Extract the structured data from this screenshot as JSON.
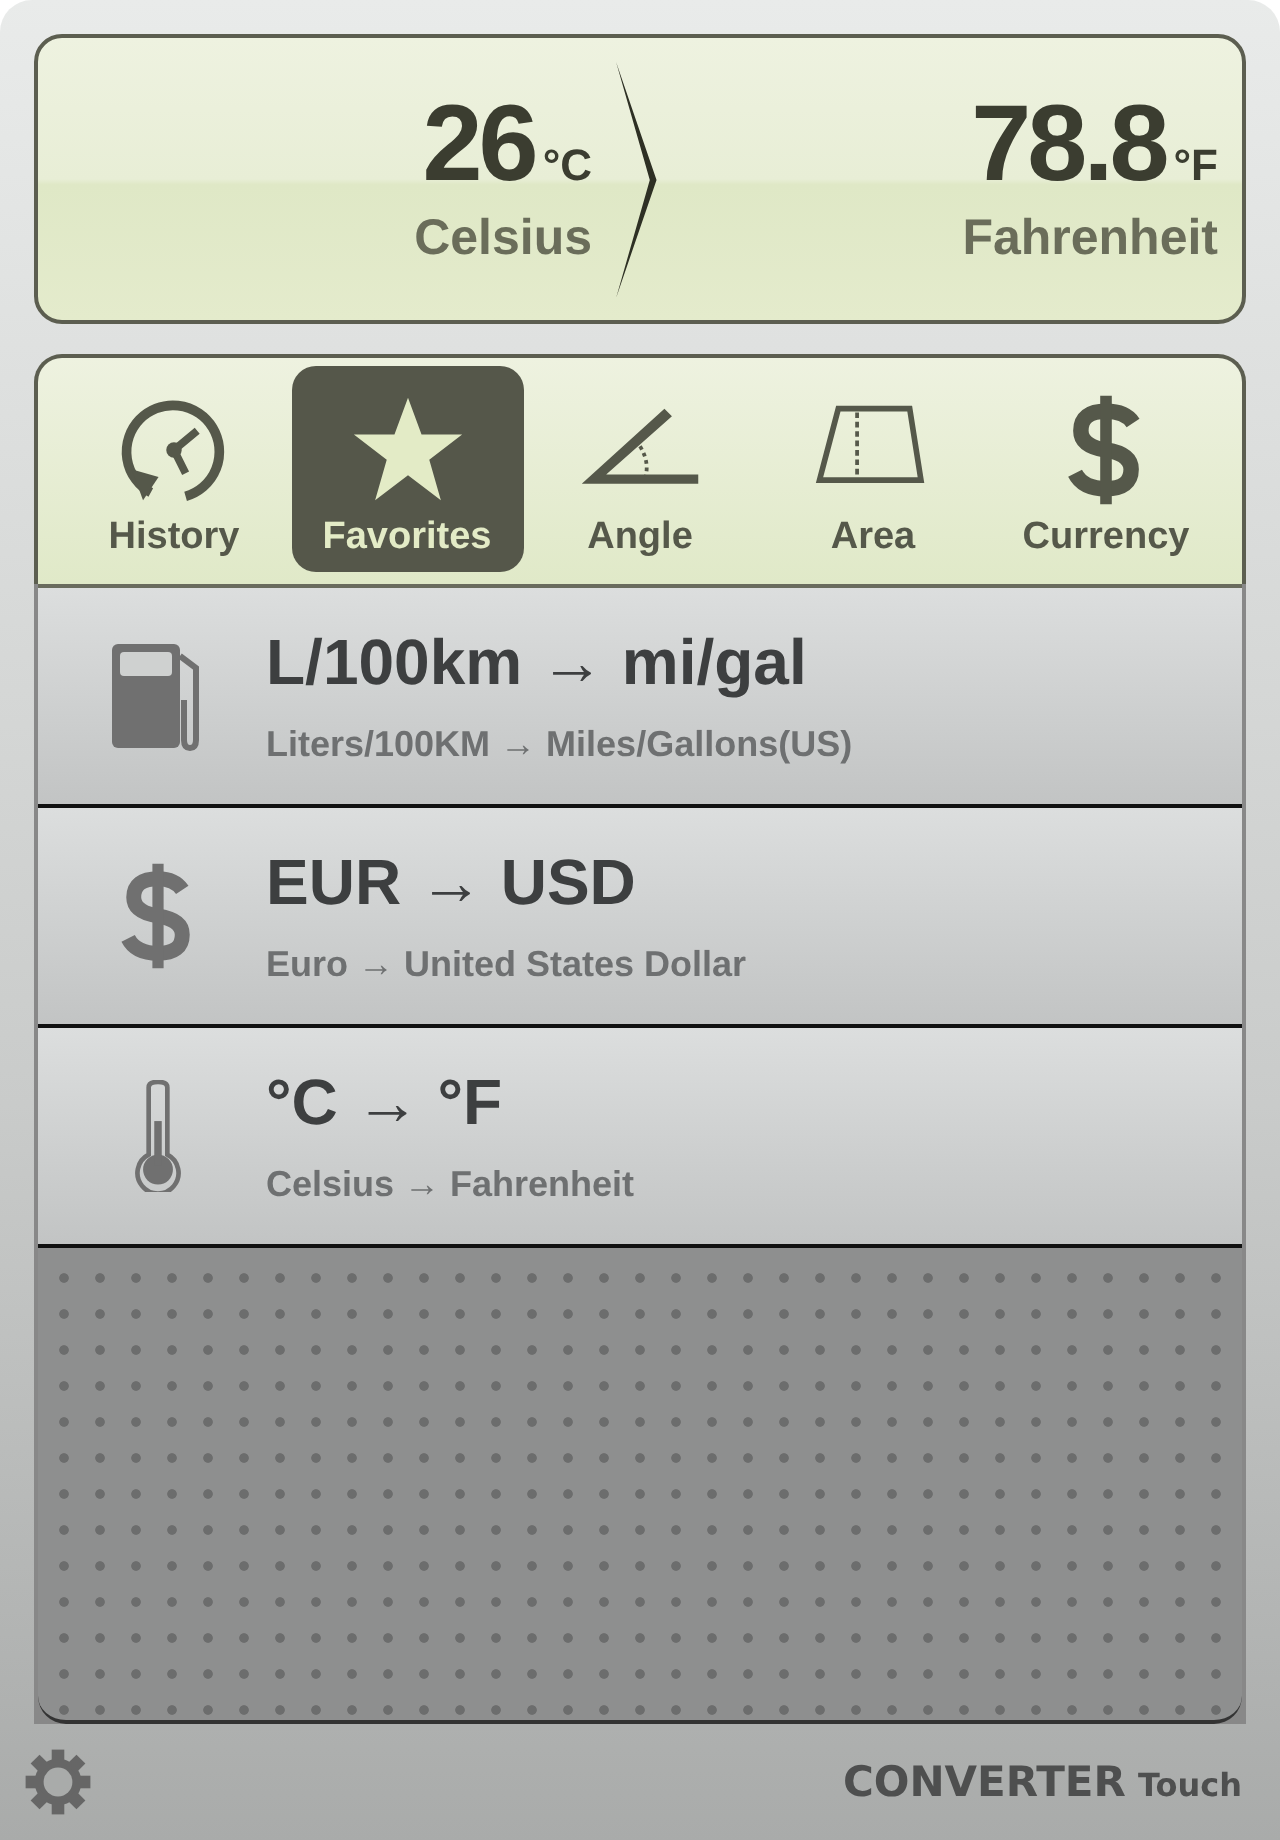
{
  "display": {
    "from": {
      "value": "26",
      "unit": "°C",
      "name": "Celsius"
    },
    "to": {
      "value": "78.8",
      "unit": "°F",
      "name": "Fahrenheit"
    }
  },
  "tabs": [
    {
      "label": "History",
      "kind": "history",
      "selected": false
    },
    {
      "label": "Favorites",
      "kind": "star",
      "selected": true
    },
    {
      "label": "Angle",
      "kind": "angle",
      "selected": false
    },
    {
      "label": "Area",
      "kind": "area",
      "selected": false
    },
    {
      "label": "Currency",
      "kind": "dollar",
      "selected": false
    }
  ],
  "favorites": [
    {
      "kind": "fuel",
      "title": "L/100km → mi/gal",
      "subtitle": "Liters/100KM → Miles/Gallons(US)"
    },
    {
      "kind": "dollar",
      "title": "EUR → USD",
      "subtitle": "Euro → United States Dollar"
    },
    {
      "kind": "thermometer",
      "title": "°C → °F",
      "subtitle": "Celsius → Fahrenheit"
    }
  ],
  "footer": {
    "brand": "CONVERTER",
    "suffix": "Touch"
  }
}
